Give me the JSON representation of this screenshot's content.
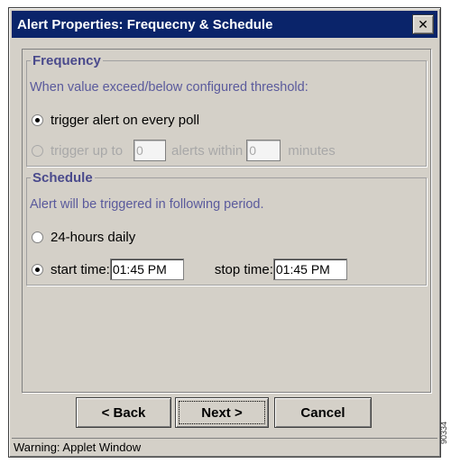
{
  "window": {
    "title": "Alert Properties: Frequecny & Schedule",
    "close_glyph": "✕"
  },
  "frequency": {
    "legend": "Frequency",
    "hint": "When value exceed/below configured threshold:",
    "option_every_poll": {
      "label": "trigger alert on every poll",
      "selected": true
    },
    "option_limited": {
      "label_prefix": "trigger up to",
      "alerts_value": "0",
      "label_middle": "alerts within",
      "minutes_value": "0",
      "label_suffix": "minutes",
      "selected": false,
      "enabled": false
    }
  },
  "schedule": {
    "legend": "Schedule",
    "hint": "Alert will be triggered in following period.",
    "option_daily": {
      "label": "24-hours daily",
      "selected": false
    },
    "option_period": {
      "label": "start  time:",
      "start_time": "01:45 PM",
      "stop_label": "stop time:",
      "stop_time": "01:45 PM",
      "selected": true
    }
  },
  "buttons": {
    "back": "< Back",
    "next": "Next >",
    "cancel": "Cancel"
  },
  "status": {
    "warning": "Warning: Applet Window"
  },
  "figure_id": "90334"
}
